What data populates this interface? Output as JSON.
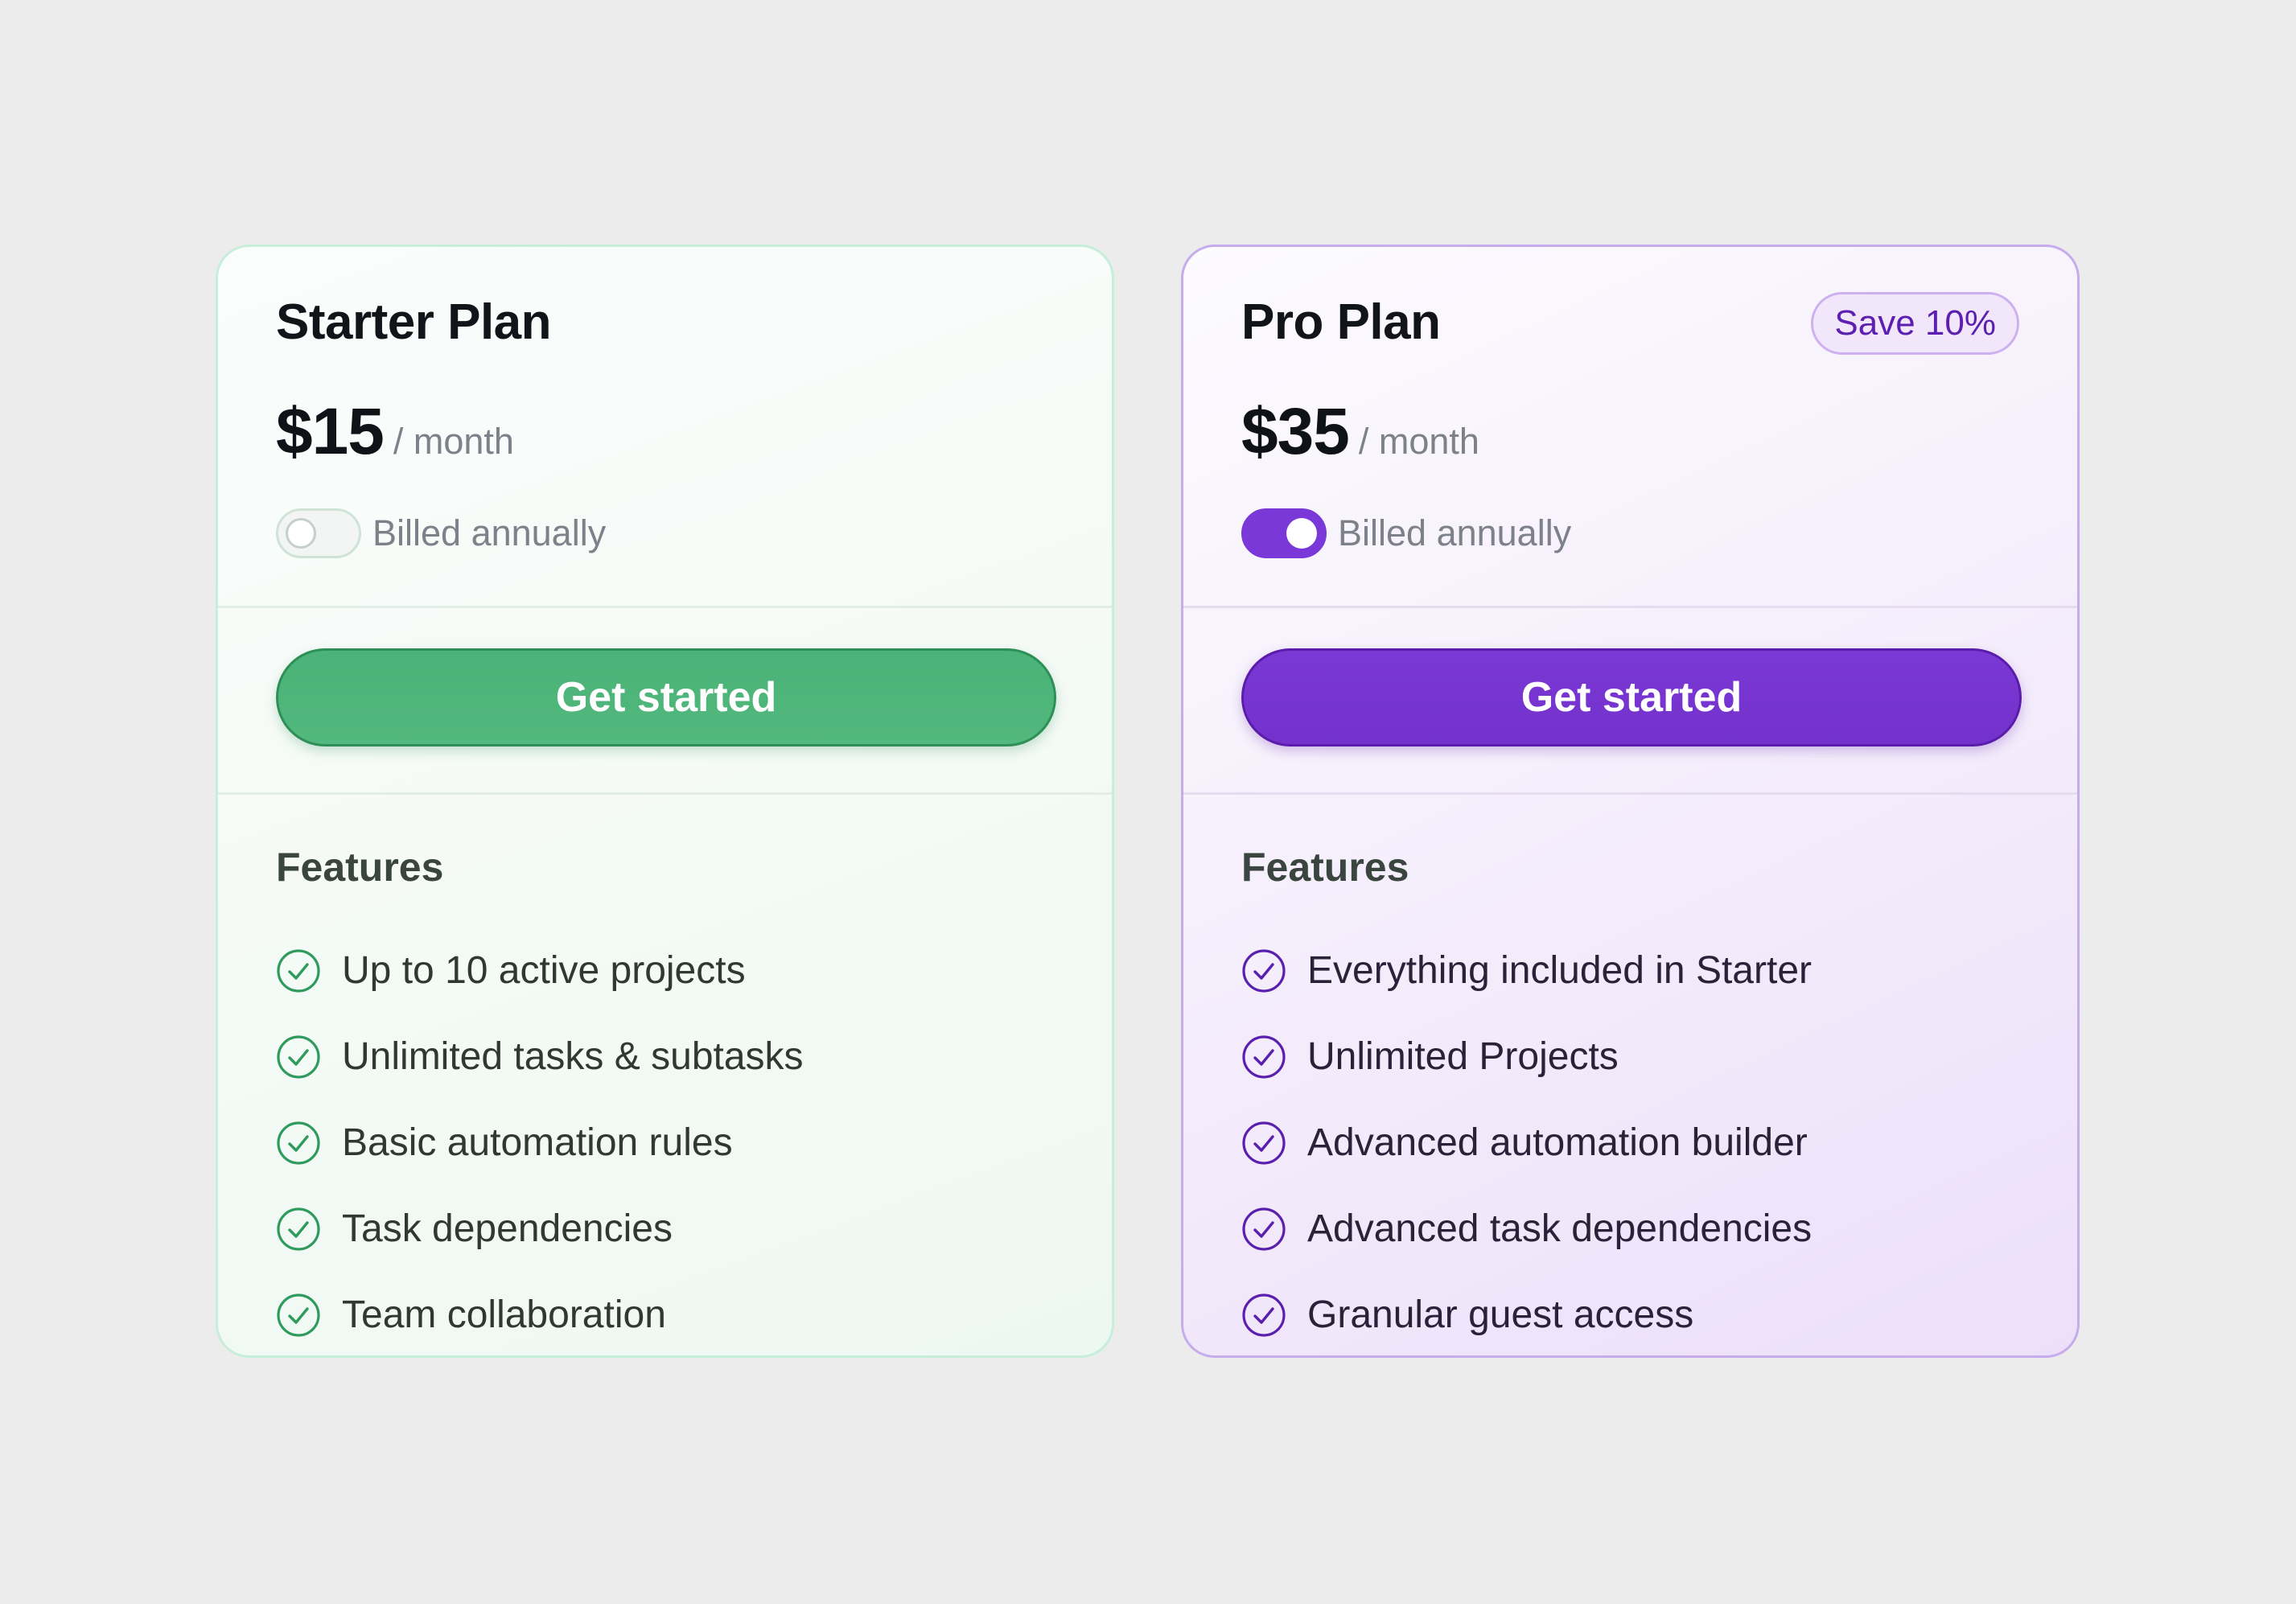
{
  "colors": {
    "background": "#ececec",
    "starter_accent": "#4bb377",
    "pro_accent": "#7a38d4",
    "badge_text": "#5c1fb0"
  },
  "plans": [
    {
      "id": "starter",
      "title": "Starter Plan",
      "price": "$15",
      "period": "/ month",
      "billing_label": "Billed annually",
      "billed_annually": false,
      "cta_label": "Get started",
      "features_title": "Features",
      "features": [
        "Up to 10 active projects",
        "Unlimited tasks & subtasks",
        "Basic automation rules",
        "Task dependencies",
        "Team collaboration"
      ],
      "feature_icon": "check-circle-icon"
    },
    {
      "id": "pro",
      "title": "Pro Plan",
      "badge": "Save 10%",
      "price": "$35",
      "period": "/ month",
      "billing_label": "Billed annually",
      "billed_annually": true,
      "cta_label": "Get started",
      "features_title": "Features",
      "features": [
        "Everything included in Starter",
        "Unlimited Projects",
        "Advanced automation builder",
        "Advanced task dependencies",
        "Granular guest access"
      ],
      "feature_icon": "check-circle-icon"
    }
  ]
}
